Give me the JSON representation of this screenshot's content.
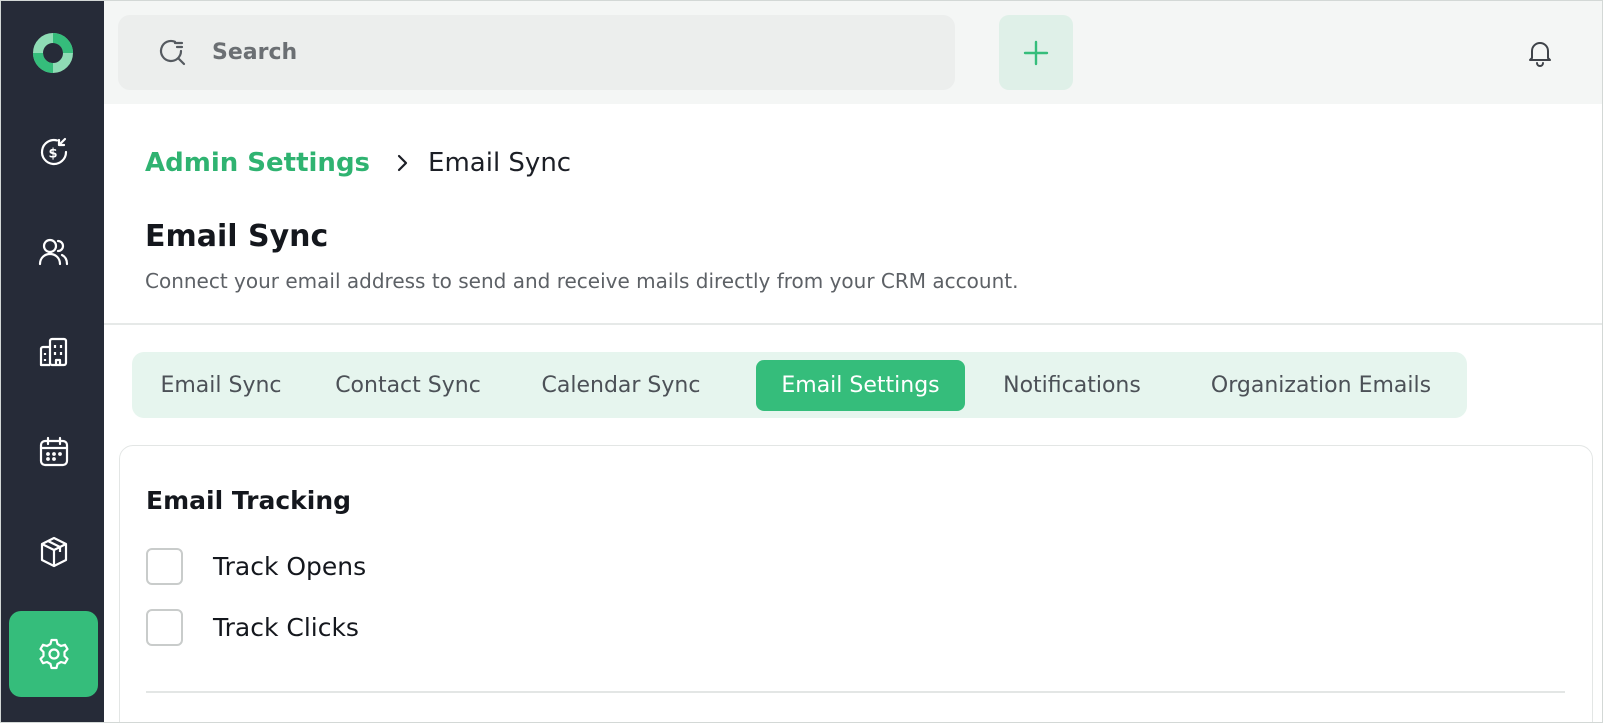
{
  "colors": {
    "accent": "#35bd7b",
    "sidebar_bg": "#262b38",
    "link": "#2fb371"
  },
  "sidebar": {
    "items": [
      {
        "icon": "logo-icon",
        "active": false
      },
      {
        "icon": "dollar-refresh-icon",
        "active": false
      },
      {
        "icon": "users-icon",
        "active": false
      },
      {
        "icon": "building-icon",
        "active": false
      },
      {
        "icon": "calendar-icon",
        "active": false
      },
      {
        "icon": "package-icon",
        "active": false
      },
      {
        "icon": "gear-icon",
        "active": true
      }
    ]
  },
  "topbar": {
    "search_placeholder": "Search",
    "add_icon": "plus-icon",
    "notification_icon": "bell-icon"
  },
  "breadcrumb": {
    "parent": "Admin Settings",
    "current": "Email Sync"
  },
  "header": {
    "title": "Email Sync",
    "description": "Connect your email address to send and receive mails directly from your CRM account."
  },
  "tabs": [
    {
      "label": "Email Sync",
      "active": false
    },
    {
      "label": "Contact Sync",
      "active": false
    },
    {
      "label": "Calendar Sync",
      "active": false
    },
    {
      "label": "Email Settings",
      "active": true
    },
    {
      "label": "Notifications",
      "active": false
    },
    {
      "label": "Organization Emails",
      "active": false
    }
  ],
  "email_tracking": {
    "title": "Email Tracking",
    "options": [
      {
        "label": "Track Opens",
        "checked": false
      },
      {
        "label": "Track Clicks",
        "checked": false
      }
    ]
  }
}
